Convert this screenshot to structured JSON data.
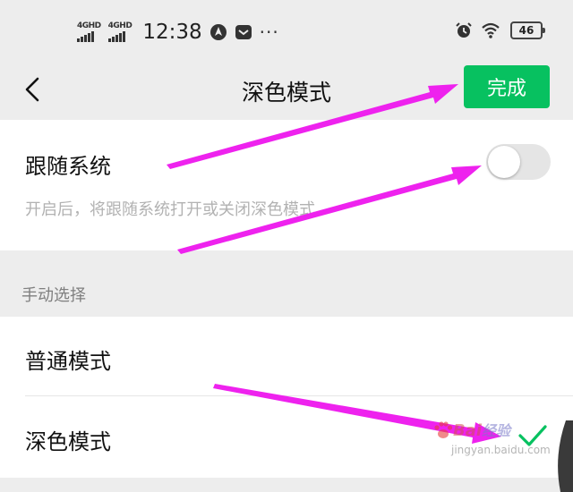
{
  "status_bar": {
    "network_1": "4GHD",
    "network_2": "4GHD",
    "time": "12:38",
    "more": "···",
    "battery": "46",
    "icons": [
      "signal-icon",
      "signal-icon",
      "navigation-icon",
      "message-icon",
      "alarm-icon",
      "wifi-icon",
      "battery-icon"
    ]
  },
  "nav": {
    "title": "深色模式",
    "done_label": "完成",
    "back_icon": "chevron-left-icon"
  },
  "follow_system": {
    "title": "跟随系统",
    "description": "开启后，将跟随系统打开或关闭深色模式",
    "enabled": false
  },
  "manual": {
    "section_label": "手动选择",
    "options": [
      {
        "label": "普通模式",
        "selected": false
      },
      {
        "label": "深色模式",
        "selected": true
      }
    ]
  },
  "watermark": {
    "brand": "Bai",
    "brand_suffix": "经验",
    "url": "jingyan.baidu.com"
  },
  "colors": {
    "accent": "#07c160",
    "background": "#ededed",
    "annotation_arrow": "#ee22ee",
    "description_text": "#b2b2b2"
  }
}
